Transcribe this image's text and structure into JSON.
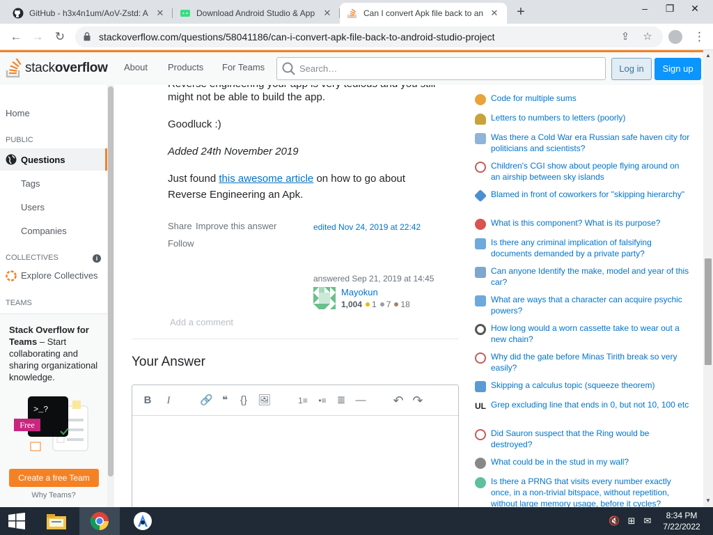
{
  "browser": {
    "tabs": [
      {
        "title": "GitHub - h3x4n1um/AoV-Zstd: A",
        "icon": "github-icon",
        "active": false
      },
      {
        "title": "Download Android Studio & App",
        "icon": "android-studio-icon",
        "active": false
      },
      {
        "title": "Can I convert Apk file back to an",
        "icon": "stackoverflow-icon",
        "active": true
      }
    ],
    "new_tab": "+",
    "url": "stackoverflow.com/questions/58041186/can-i-convert-apk-file-back-to-android-studio-project"
  },
  "so_header": {
    "logo_plain": "stack",
    "logo_bold": "overflow",
    "nav": [
      "About",
      "Products",
      "For Teams"
    ],
    "search_placeholder": "Search…",
    "login": "Log in",
    "signup": "Sign up",
    "accent": "#f48225"
  },
  "left_nav": {
    "home": "Home",
    "public_heading": "PUBLIC",
    "questions": "Questions",
    "tags": "Tags",
    "users": "Users",
    "companies": "Companies",
    "collectives_heading": "COLLECTIVES",
    "explore_collectives": "Explore Collectives",
    "teams_heading": "TEAMS",
    "teams_promo_bold": "Stack Overflow for Teams",
    "teams_promo_rest": " – Start collaborating and sharing organizational knowledge.",
    "free_badge": "Free",
    "create_team": "Create a free Team",
    "why_teams": "Why Teams?"
  },
  "answer": {
    "partial_line_top": "Reverse engineering your app is very tedious and you still",
    "line_1": "might not be able to build the app.",
    "line_2": "Goodluck :)",
    "line_3": "Added 24th November 2019",
    "line_4_pre": "Just found ",
    "line_4_link": "this awesome article",
    "line_4_post": " on how to go about Reverse Engineering an Apk.",
    "share": "Share",
    "improve": "Improve this answer",
    "follow": "Follow",
    "edited": "edited Nov 24, 2019 at 22:42",
    "answered": "answered Sep 21, 2019 at 14:45",
    "user": {
      "name": "Mayokun",
      "reputation": "1,004",
      "gold": "1",
      "silver": "7",
      "bronze": "18"
    },
    "add_comment": "Add a comment"
  },
  "your_answer": {
    "heading": "Your Answer",
    "toolbar": [
      "B",
      "I",
      "🔗",
      "❝",
      "{}",
      "🖼",
      "1≡",
      "•≡",
      "≣",
      "—",
      "↶",
      "↷"
    ]
  },
  "hot_network_questions": [
    {
      "title": "Code for multiple sums",
      "site_color": "#e8a33a"
    },
    {
      "title": "Letters to numbers to letters (poorly)",
      "site_color": "#c9a23c"
    },
    {
      "title": "Was there a Cold War era Russian safe haven city for politicians and scientists?",
      "site_color": "#8fb3d9"
    },
    {
      "title": "Children's CGI show about people flying around on an airship between sky islands",
      "site_color": "#c45b5b"
    },
    {
      "title": "Blamed in front of coworkers for \"skipping hierarchy\"",
      "site_color": "#4b8fd1"
    },
    {
      "title": "What is this component? What is its purpose?",
      "site_color": "#d9534f"
    },
    {
      "title": "Is there any criminal implication of falsifying documents demanded by a private party?",
      "site_color": "#6fa8dc"
    },
    {
      "title": "Can anyone Identify the make, model and year of this car?",
      "site_color": "#7fa6cf"
    },
    {
      "title": "What are ways that a character can acquire psychic powers?",
      "site_color": "#6fa8dc"
    },
    {
      "title": "How long would a worn cassette take to wear out a new chain?",
      "site_color": "#555555"
    },
    {
      "title": "Why did the gate before Minas Tirith break so very easily?",
      "site_color": "#c45b5b"
    },
    {
      "title": "Skipping a calculus topic (squeeze theorem)",
      "site_color": "#5b9bd5"
    },
    {
      "title": "Grep excluding line that ends in 0, but not 10, 100 etc",
      "site_color": "#222222"
    },
    {
      "title": "Did Sauron suspect that the Ring would be destroyed?",
      "site_color": "#c45b5b"
    },
    {
      "title": "What could be in the stud in my wall?",
      "site_color": "#888888"
    },
    {
      "title": "Is there a PRNG that visits every number exactly once, in a non-trivial bitspace, without repetition, without large memory usage, before it cycles?",
      "site_color": "#5fbf9f"
    }
  ],
  "taskbar": {
    "time": "8:34 PM",
    "date": "7/22/2022",
    "bg": "#1f2a36"
  }
}
